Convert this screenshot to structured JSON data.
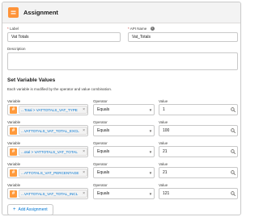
{
  "header": {
    "title": "Assignment"
  },
  "details": {
    "label_label": "Label",
    "label_value": "Vat Totals",
    "api_name_label": "API Name",
    "api_name_value": "Vat_Totals",
    "description_label": "Description",
    "required_mark": "*",
    "info_glyph": "i"
  },
  "section": {
    "title": "Set Variable Values",
    "description": "Each variable is modified by the operator and value combination."
  },
  "columns": {
    "variable": "Variable",
    "operator": "Operator",
    "value": "Value"
  },
  "rows": [
    {
      "variable": "...Total > VATTOTALS_VAT_TYPE",
      "operator": "Equals",
      "value": "1"
    },
    {
      "variable": "...VATTOTALS_VAT_TOTAL_EXCL",
      "operator": "Equals",
      "value": "100"
    },
    {
      "variable": "...otal > VATTOTALS_VAT_TOTAL",
      "operator": "Equals",
      "value": "21"
    },
    {
      "variable": "...ATTOTALS_VAT_PERCENTAGE",
      "operator": "Equals",
      "value": "21"
    },
    {
      "variable": "...VATTOTALS_VAT_TOTAL_INCL",
      "operator": "Equals",
      "value": "121"
    }
  ],
  "add_button": {
    "label": "Add Assignment",
    "plus": "+"
  },
  "glyphs": {
    "var_icon": "#",
    "remove": "×",
    "caret": "▼"
  },
  "icons": {
    "header": "equals-icon",
    "search": "search-icon"
  },
  "colors": {
    "header_icon": "#fe9339",
    "variable_icon": "#ff9a3c",
    "link": "#0176d3"
  }
}
